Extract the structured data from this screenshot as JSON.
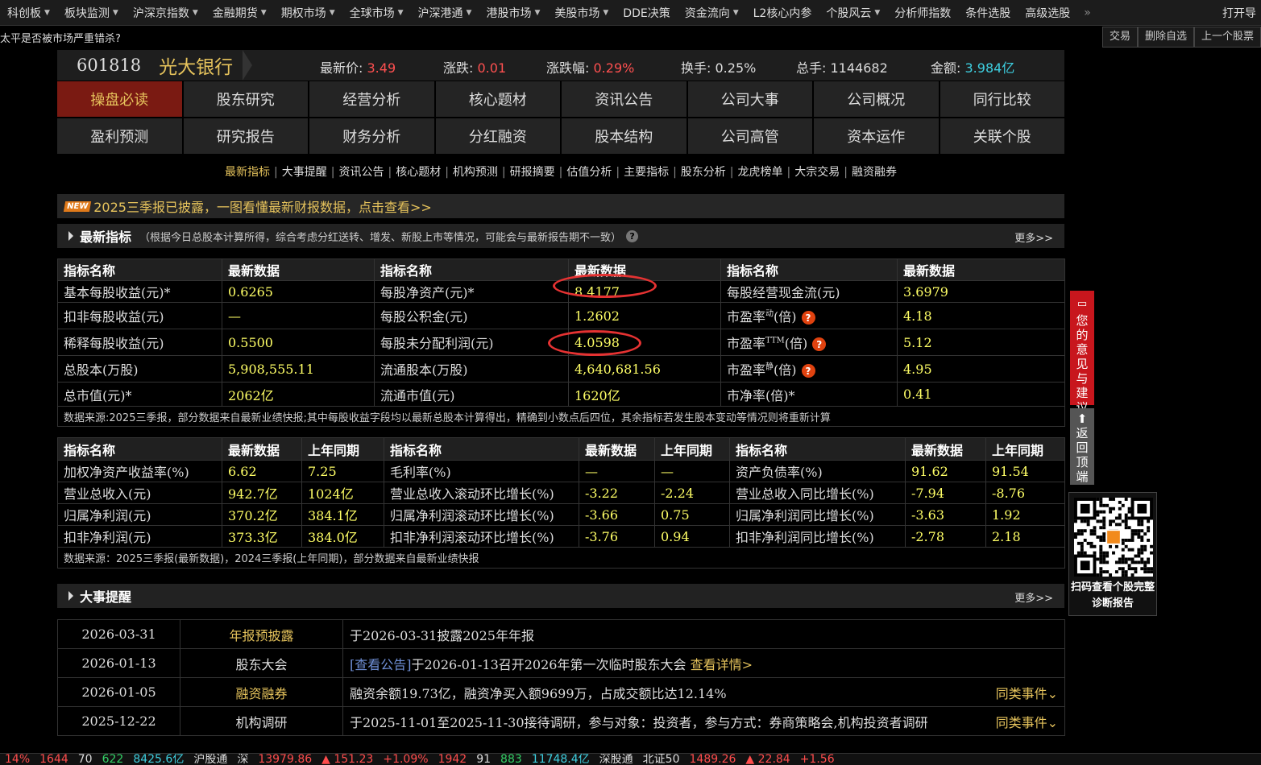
{
  "nav": {
    "items": [
      {
        "label": "科创板",
        "dd": true
      },
      {
        "label": "板块监测",
        "dd": true
      },
      {
        "label": "沪深京指数",
        "dd": true
      },
      {
        "label": "金融期货",
        "dd": true
      },
      {
        "label": "期权市场",
        "dd": true
      },
      {
        "label": "全球市场",
        "dd": true
      },
      {
        "label": "沪深港通",
        "dd": true
      },
      {
        "label": "港股市场",
        "dd": true
      },
      {
        "label": "美股市场",
        "dd": true
      },
      {
        "label": "DDE决策",
        "dd": false
      },
      {
        "label": "资金流向",
        "dd": true
      },
      {
        "label": "L2核心内参",
        "dd": false
      },
      {
        "label": "个股风云",
        "dd": true
      },
      {
        "label": "分析师指数",
        "dd": false
      },
      {
        "label": "条件选股",
        "dd": false
      },
      {
        "label": "高级选股",
        "dd": false
      }
    ],
    "more": "»",
    "open_label": "打开导"
  },
  "ticker": "太平是否被市场严重错杀?",
  "actions": [
    "交易",
    "删除自选",
    "上一个股票"
  ],
  "stock": {
    "code": "601818",
    "name": "光大银行",
    "price_label": "最新价:",
    "price": "3.49",
    "chg_label": "涨跌:",
    "chg": "0.01",
    "pct_label": "涨跌幅:",
    "pct": "0.29%",
    "turnover_label": "换手:",
    "turnover": "0.25%",
    "vol_label": "总手:",
    "vol": "1144682",
    "amt_label": "金额:",
    "amt": "3.984亿"
  },
  "tabs": [
    "操盘必读",
    "股东研究",
    "经营分析",
    "核心题材",
    "资讯公告",
    "公司大事",
    "公司概况",
    "同行比较",
    "盈利预测",
    "研究报告",
    "财务分析",
    "分红融资",
    "股本结构",
    "公司高管",
    "资本运作",
    "关联个股"
  ],
  "subnav": [
    "最新指标",
    "大事提醒",
    "资讯公告",
    "核心题材",
    "机构预测",
    "研报摘要",
    "估值分析",
    "主要指标",
    "股东分析",
    "龙虎榜单",
    "大宗交易",
    "融资融券"
  ],
  "banner": {
    "badge": "NEW",
    "text": "2025三季报已披露，一图看懂最新财报数据，点击查看>>"
  },
  "section1": {
    "title": "最新指标",
    "note": "（根据今日总股本计算所得，综合考虑分红送转、增发、新股上市等情况，可能会与最新报告期不一致）",
    "help": "?",
    "more": "更多>>"
  },
  "t1": {
    "headers": [
      "指标名称",
      "最新数据",
      "指标名称",
      "最新数据",
      "指标名称",
      "最新数据"
    ],
    "rows": [
      [
        "基本每股收益(元)*",
        "0.6265",
        "每股净资产(元)*",
        "8.4177",
        "每股经营现金流(元)",
        "3.6979"
      ],
      [
        "扣非每股收益(元)",
        "—",
        "每股公积金(元)",
        "1.2602",
        "市盈率",
        "4.18"
      ],
      [
        "稀释每股收益(元)",
        "0.5500",
        "每股未分配利润(元)",
        "4.0598",
        "市盈率",
        "5.12"
      ],
      [
        "总股本(万股)",
        "5,908,555.11",
        "流通股本(万股)",
        "4,640,681.56",
        "市盈率",
        "4.95"
      ],
      [
        "总市值(元)*",
        "2062亿",
        "流通市值(元)",
        "1620亿",
        "市净率(倍)*",
        "0.41"
      ]
    ],
    "pe_sups": [
      "动",
      "TTM",
      "静"
    ],
    "pe_unit": "(倍)",
    "help": "?",
    "note": "数据来源:2025三季报，部分数据来自最新业绩快报;其中每股收益字段均以最新总股本计算得出，精确到小数点后四位，其余指标若发生股本变动等情况则将重新计算"
  },
  "t2": {
    "headers": [
      "指标名称",
      "最新数据",
      "上年同期",
      "指标名称",
      "最新数据",
      "上年同期",
      "指标名称",
      "最新数据",
      "上年同期"
    ],
    "rows": [
      [
        "加权净资产收益率(%)",
        "6.62",
        "7.25",
        "毛利率(%)",
        "—",
        "—",
        "资产负债率(%)",
        "91.62",
        "91.54"
      ],
      [
        "营业总收入(元)",
        "942.7亿",
        "1024亿",
        "营业总收入滚动环比增长(%)",
        "-3.22",
        "-2.24",
        "营业总收入同比增长(%)",
        "-7.94",
        "-8.76"
      ],
      [
        "归属净利润(元)",
        "370.2亿",
        "384.1亿",
        "归属净利润滚动环比增长(%)",
        "-3.66",
        "0.75",
        "归属净利润同比增长(%)",
        "-3.63",
        "1.92"
      ],
      [
        "扣非净利润(元)",
        "373.3亿",
        "384.0亿",
        "扣非净利润滚动环比增长(%)",
        "-3.76",
        "0.94",
        "扣非净利润同比增长(%)",
        "-2.78",
        "2.18"
      ]
    ],
    "note": "数据来源：2025三季报(最新数据)，2024三季报(上年同期)，部分数据来自最新业绩快报"
  },
  "section2": {
    "title": "大事提醒",
    "more": "更多>>"
  },
  "events": [
    {
      "date": "2026-03-31",
      "cat": "年报预披露",
      "cat_gold": true,
      "pre": "",
      "text": "于2026-03-31披露2025年年报",
      "link": "",
      "same": ""
    },
    {
      "date": "2026-01-13",
      "cat": "股东大会",
      "cat_gold": false,
      "pre": "[查看公告]",
      "text": "于2026-01-13召开2026年第一次临时股东大会",
      "link": "查看详情>",
      "same": ""
    },
    {
      "date": "2026-01-05",
      "cat": "融资融券",
      "cat_gold": true,
      "pre": "",
      "text": "融资余额19.73亿，融资净买入额9699万，占成交额比达12.14%",
      "link": "",
      "same": "同类事件⌄"
    },
    {
      "date": "2025-12-22",
      "cat": "机构调研",
      "cat_gold": false,
      "pre": "",
      "text": "于2025-11-01至2025-11-30接待调研，参与对象：投资者，参与方式：券商策略会,机构投资者调研",
      "link": "",
      "same": "同类事件⌄"
    }
  ],
  "side": {
    "feedback": "您的意见与建议",
    "totop": "返回顶端",
    "qr_caption": "扫码查看个股完整诊断报告"
  },
  "bottom": [
    {
      "t": "14%",
      "c": "r"
    },
    {
      "t": "1644",
      "c": "r"
    },
    {
      "t": "70",
      "c": "w"
    },
    {
      "t": "622",
      "c": "g"
    },
    {
      "t": "8425.6亿",
      "c": "c"
    },
    {
      "t": "沪股通",
      "c": "w"
    },
    {
      "t": "深",
      "c": "w"
    },
    {
      "t": "13979.86",
      "c": "r"
    },
    {
      "t": "▲ 151.23",
      "c": "r"
    },
    {
      "t": "+1.09%",
      "c": "r"
    },
    {
      "t": "1942",
      "c": "r"
    },
    {
      "t": "91",
      "c": "w"
    },
    {
      "t": "883",
      "c": "g"
    },
    {
      "t": "11748.4亿",
      "c": "c"
    },
    {
      "t": "深股通",
      "c": "w"
    },
    {
      "t": "北证50",
      "c": "w"
    },
    {
      "t": "1489.26",
      "c": "r"
    },
    {
      "t": "▲ 22.84",
      "c": "r"
    },
    {
      "t": "+1.56",
      "c": "r"
    }
  ],
  "colors": {
    "accent_gold": "#e6c35c",
    "up_red": "#ff5050",
    "active_tab": "#7a1a12",
    "value_yellow": "#ffff66"
  }
}
